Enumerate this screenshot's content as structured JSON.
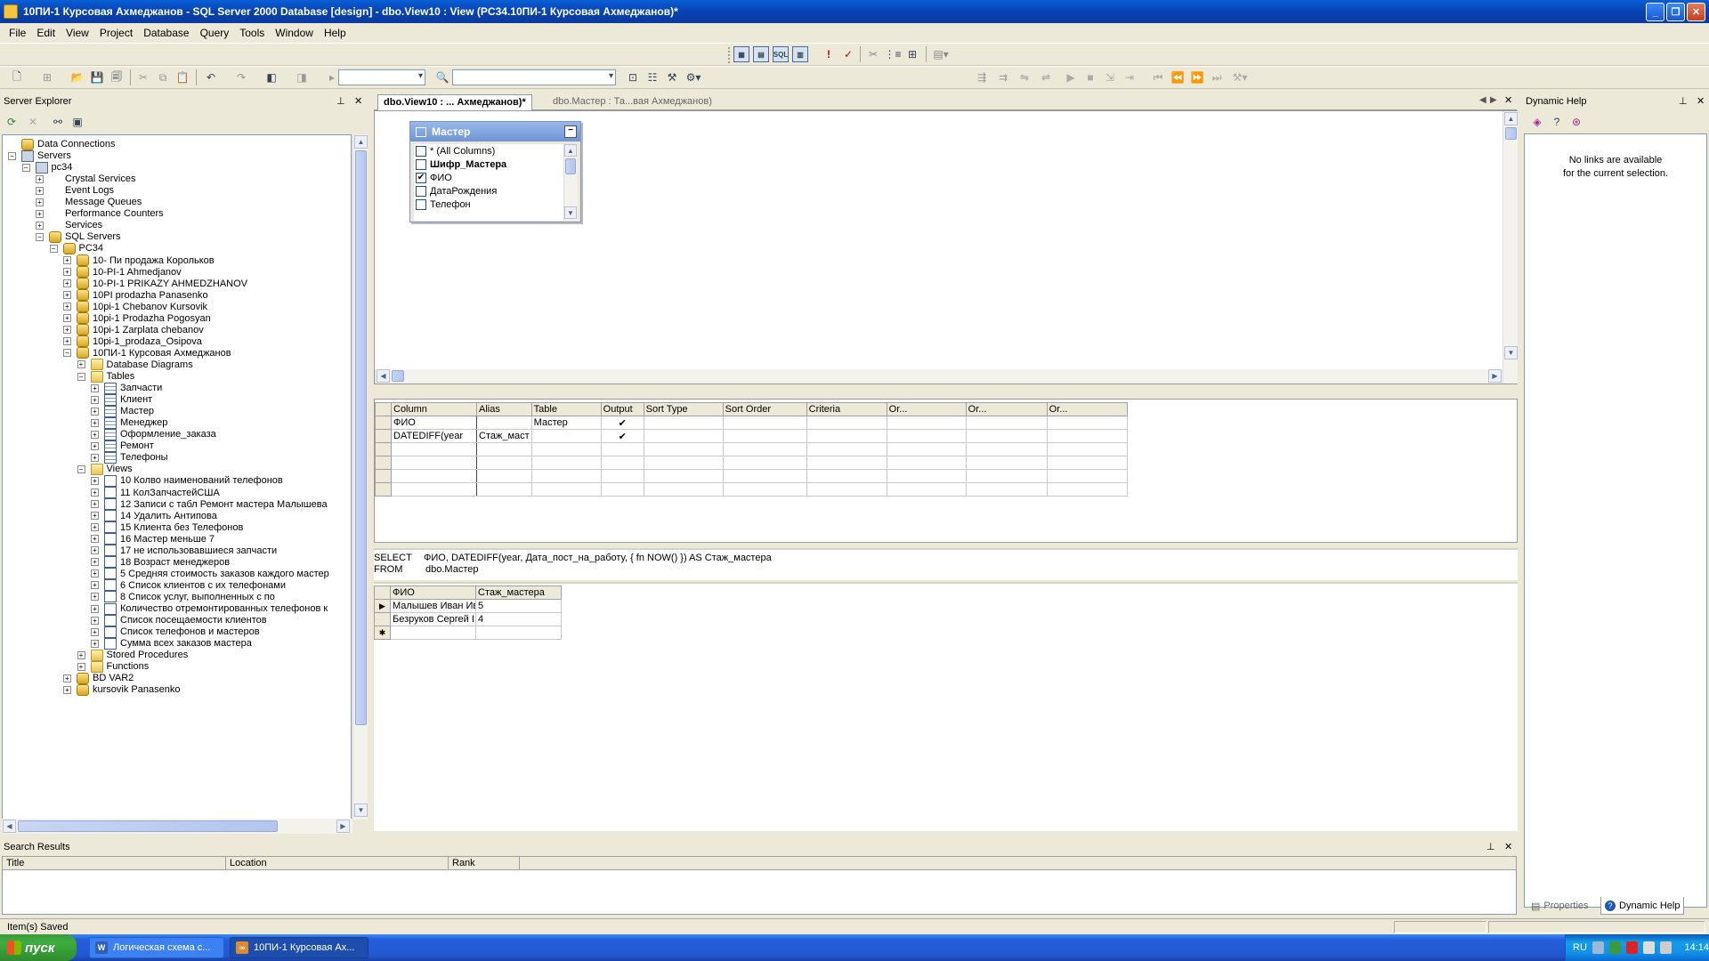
{
  "window": {
    "title": "10ПИ-1 Курсовая Ахмеджанов - SQL Server 2000 Database [design] - dbo.View10 : View (PC34.10ПИ-1 Курсовая Ахмеджанов)*"
  },
  "menu": [
    "File",
    "Edit",
    "View",
    "Project",
    "Database",
    "Query",
    "Tools",
    "Window",
    "Help"
  ],
  "server_explorer": {
    "title": "Server Explorer",
    "items": [
      {
        "label": "Data Connections",
        "level": 0,
        "exp": "",
        "icon": "database-icon"
      },
      {
        "label": "Servers",
        "level": 0,
        "exp": "−",
        "icon": "server-icon"
      },
      {
        "label": "pc34",
        "level": 1,
        "exp": "−",
        "icon": "computer-icon"
      },
      {
        "label": "Crystal Services",
        "level": 2,
        "exp": "+",
        "icon": "crystal-icon"
      },
      {
        "label": "Event Logs",
        "level": 2,
        "exp": "+",
        "icon": "event-log-icon"
      },
      {
        "label": "Message Queues",
        "level": 2,
        "exp": "+",
        "icon": "message-queue-icon"
      },
      {
        "label": "Performance Counters",
        "level": 2,
        "exp": "+",
        "icon": "perf-counter-icon"
      },
      {
        "label": "Services",
        "level": 2,
        "exp": "+",
        "icon": "services-icon"
      },
      {
        "label": "SQL Servers",
        "level": 2,
        "exp": "−",
        "icon": "sql-servers-icon"
      },
      {
        "label": "PC34",
        "level": 3,
        "exp": "−",
        "icon": "sql-server-icon"
      },
      {
        "label": "10- Пи продажа Корольков",
        "level": 4,
        "exp": "+",
        "icon": "database-icon"
      },
      {
        "label": "10-PI-1 Ahmedjanov",
        "level": 4,
        "exp": "+",
        "icon": "database-icon"
      },
      {
        "label": "10-PI-1 PRIKAZY AHMEDZHANOV",
        "level": 4,
        "exp": "+",
        "icon": "database-icon"
      },
      {
        "label": "10PI prodazha Panasenko",
        "level": 4,
        "exp": "+",
        "icon": "database-icon"
      },
      {
        "label": "10pi-1 Chebanov Kursovik",
        "level": 4,
        "exp": "+",
        "icon": "database-icon"
      },
      {
        "label": "10pi-1 Prodazha Pogosyan",
        "level": 4,
        "exp": "+",
        "icon": "database-icon"
      },
      {
        "label": "10pi-1 Zarplata chebanov",
        "level": 4,
        "exp": "+",
        "icon": "database-icon"
      },
      {
        "label": "10pi-1_prodaza_Osipova",
        "level": 4,
        "exp": "+",
        "icon": "database-icon"
      },
      {
        "label": "10ПИ-1 Курсовая Ахмеджанов",
        "level": 4,
        "exp": "−",
        "icon": "database-icon"
      },
      {
        "label": "Database Diagrams",
        "level": 5,
        "exp": "+",
        "icon": "folder-icon"
      },
      {
        "label": "Tables",
        "level": 5,
        "exp": "−",
        "icon": "folder-icon"
      },
      {
        "label": "Запчасти",
        "level": 6,
        "exp": "+",
        "icon": "table-icon"
      },
      {
        "label": "Клиент",
        "level": 6,
        "exp": "+",
        "icon": "table-icon"
      },
      {
        "label": "Мастер",
        "level": 6,
        "exp": "+",
        "icon": "table-icon"
      },
      {
        "label": "Менеджер",
        "level": 6,
        "exp": "+",
        "icon": "table-icon"
      },
      {
        "label": "Оформление_заказа",
        "level": 6,
        "exp": "+",
        "icon": "table-icon"
      },
      {
        "label": "Ремонт",
        "level": 6,
        "exp": "+",
        "icon": "table-icon"
      },
      {
        "label": "Телефоны",
        "level": 6,
        "exp": "+",
        "icon": "table-icon"
      },
      {
        "label": "Views",
        "level": 5,
        "exp": "−",
        "icon": "folder-icon"
      },
      {
        "label": "10 Колво наименований телефонов",
        "level": 6,
        "exp": "+",
        "icon": "view-icon"
      },
      {
        "label": "11 КолЗапчастейСША",
        "level": 6,
        "exp": "+",
        "icon": "view-icon"
      },
      {
        "label": "12 Записи с табл Ремонт мастера Малышева",
        "level": 6,
        "exp": "+",
        "icon": "view-icon"
      },
      {
        "label": "14 Удалить Антипова",
        "level": 6,
        "exp": "+",
        "icon": "view-icon"
      },
      {
        "label": "15 Клиента без Телефонов",
        "level": 6,
        "exp": "+",
        "icon": "view-icon"
      },
      {
        "label": "16 Мастер меньше 7",
        "level": 6,
        "exp": "+",
        "icon": "view-icon"
      },
      {
        "label": "17 не использовавшиеся запчасти",
        "level": 6,
        "exp": "+",
        "icon": "view-icon"
      },
      {
        "label": "18 Возраст менеджеров",
        "level": 6,
        "exp": "+",
        "icon": "view-icon"
      },
      {
        "label": "5 Средняя стоимость заказов каждого мастер",
        "level": 6,
        "exp": "+",
        "icon": "view-icon"
      },
      {
        "label": "6 Список клиентов с их телефонами",
        "level": 6,
        "exp": "+",
        "icon": "view-icon"
      },
      {
        "label": "8 Список услуг, выполненных  с по",
        "level": 6,
        "exp": "+",
        "icon": "view-icon"
      },
      {
        "label": "Количество отремонтированных телефонов к",
        "level": 6,
        "exp": "+",
        "icon": "view-icon"
      },
      {
        "label": "Список посещаемости клиентов",
        "level": 6,
        "exp": "+",
        "icon": "view-icon"
      },
      {
        "label": "Список телефонов и мастеров",
        "level": 6,
        "exp": "+",
        "icon": "view-icon"
      },
      {
        "label": "Сумма всех заказов мастера",
        "level": 6,
        "exp": "+",
        "icon": "view-icon"
      },
      {
        "label": "Stored Procedures",
        "level": 5,
        "exp": "+",
        "icon": "folder-icon"
      },
      {
        "label": "Functions",
        "level": 5,
        "exp": "+",
        "icon": "folder-icon"
      },
      {
        "label": "BD VAR2",
        "level": 4,
        "exp": "+",
        "icon": "database-icon"
      },
      {
        "label": "kursovik Panasenko",
        "level": 4,
        "exp": "+",
        "icon": "database-icon"
      }
    ]
  },
  "doc_tabs": [
    {
      "label": "dbo.View10 : ... Ахмеджанов)*",
      "active": true
    },
    {
      "label": "dbo.Мастер : Та...вая Ахмеджанов)",
      "active": false
    }
  ],
  "diagram": {
    "table_name": "Мастер",
    "columns": [
      {
        "name": "* (All Columns)",
        "checked": false,
        "bold": false
      },
      {
        "name": "Шифр_Мастера",
        "checked": false,
        "bold": true
      },
      {
        "name": "ФИО",
        "checked": true,
        "bold": false
      },
      {
        "name": "ДатаРождения",
        "checked": false,
        "bold": false
      },
      {
        "name": "Телефон",
        "checked": false,
        "bold": false
      }
    ]
  },
  "criteria_grid": {
    "headers": [
      "Column",
      "Alias",
      "Table",
      "Output",
      "Sort Type",
      "Sort Order",
      "Criteria",
      "Or...",
      "Or...",
      "Or..."
    ],
    "rows": [
      [
        "ФИО",
        "",
        "Мастер",
        "✔",
        "",
        "",
        "",
        "",
        "",
        ""
      ],
      [
        "DATEDIFF(year",
        "Стаж_маст",
        "",
        "✔",
        "",
        "",
        "",
        "",
        "",
        ""
      ],
      [
        "",
        "",
        "",
        "",
        "",
        "",
        "",
        "",
        "",
        ""
      ],
      [
        "",
        "",
        "",
        "",
        "",
        "",
        "",
        "",
        "",
        ""
      ],
      [
        "",
        "",
        "",
        "",
        "",
        "",
        "",
        "",
        "",
        ""
      ],
      [
        "",
        "",
        "",
        "",
        "",
        "",
        "",
        "",
        "",
        ""
      ]
    ]
  },
  "sql": {
    "select_kw": "SELECT",
    "select_text": "ФИО, DATEDIFF(year, Дата_пост_на_работу, { fn NOW() }) AS Стаж_мастера",
    "from_kw": "FROM",
    "from_text": "dbo.Мастер"
  },
  "results": {
    "headers": [
      "ФИО",
      "Стаж_мастера"
    ],
    "rows": [
      {
        "marker": "▶",
        "cells": [
          "Малышев Иван Ив",
          "5"
        ]
      },
      {
        "marker": "",
        "cells": [
          "Безруков Сергей I",
          "4"
        ]
      },
      {
        "marker": "✱",
        "cells": [
          "",
          ""
        ]
      }
    ]
  },
  "dynamic_help": {
    "title": "Dynamic Help",
    "message_line1": "No links are available",
    "message_line2": "for the current selection.",
    "tab_properties": "Properties",
    "tab_dynamic_help": "Dynamic Help"
  },
  "search_results": {
    "title": "Search Results",
    "columns": [
      "Title",
      "Location",
      "Rank"
    ]
  },
  "status": {
    "text": "Item(s) Saved"
  },
  "taskbar": {
    "start": "пуск",
    "tasks": [
      {
        "label": "Логическая схема с...",
        "active": false
      },
      {
        "label": "10ПИ-1 Курсовая Ах...",
        "active": true
      }
    ],
    "lang": "RU",
    "clock": "14:14"
  }
}
